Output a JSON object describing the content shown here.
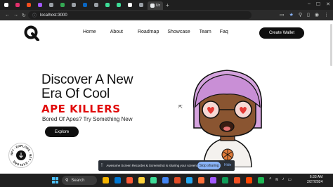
{
  "browser": {
    "active_tab_title": "Uz",
    "url": "localhost:3000",
    "tabs": [
      {
        "icon": "x-icon",
        "color": "#ffffff"
      },
      {
        "icon": "instagram-icon",
        "color": "#e1306c"
      },
      {
        "icon": "figma-icon",
        "color": "#f24e1e"
      },
      {
        "icon": "figma-icon",
        "color": "#a259ff"
      },
      {
        "icon": "page-icon",
        "color": "#9aa0a6"
      },
      {
        "icon": "page-icon",
        "color": "#34a853"
      },
      {
        "icon": "page-icon",
        "color": "#9aa0a6"
      },
      {
        "icon": "linkedin-icon",
        "color": "#0a66c2"
      },
      {
        "icon": "page-icon",
        "color": "#9aa0a6"
      },
      {
        "icon": "diamond-icon",
        "color": "#3ddc97"
      },
      {
        "icon": "diamond-icon",
        "color": "#3ddc97"
      },
      {
        "icon": "github-icon",
        "color": "#ffffff"
      },
      {
        "icon": "page-icon",
        "color": "#9aa0a6"
      }
    ]
  },
  "page": {
    "nav": [
      "Home",
      "About",
      "Roadmap",
      "Showcase",
      "Team",
      "Faq"
    ],
    "cta_label": "Create Wallet",
    "hero_line1": "Discover A New",
    "hero_line2": "Era Of Cool",
    "hero_accent": "APE KILLERS",
    "subtitle": "Bored Of Apes? Try Something New",
    "explore_label": "Explore",
    "badge_text": "NFT · EXPLORE · NFT · EXPLORE",
    "accent_color": "#e10c0c"
  },
  "share_notice": {
    "message": "Awesome Screen Recorder & Screenshot is sharing your screen.",
    "stop_label": "Stop sharing",
    "hide_label": "Hide"
  },
  "taskbar": {
    "search_label": "Search",
    "time": "6:33 AM",
    "date": "2/27/2024",
    "apps": [
      "#f4b400",
      "#0078d4",
      "#ff5a36",
      "#ffd43b",
      "#3ddc97",
      "#4285f4",
      "#e34c26",
      "#23a8f2",
      "#ff7139",
      "#a259ff",
      "#0f9d58",
      "#f25022",
      "#ff4500",
      "#1db954"
    ]
  }
}
